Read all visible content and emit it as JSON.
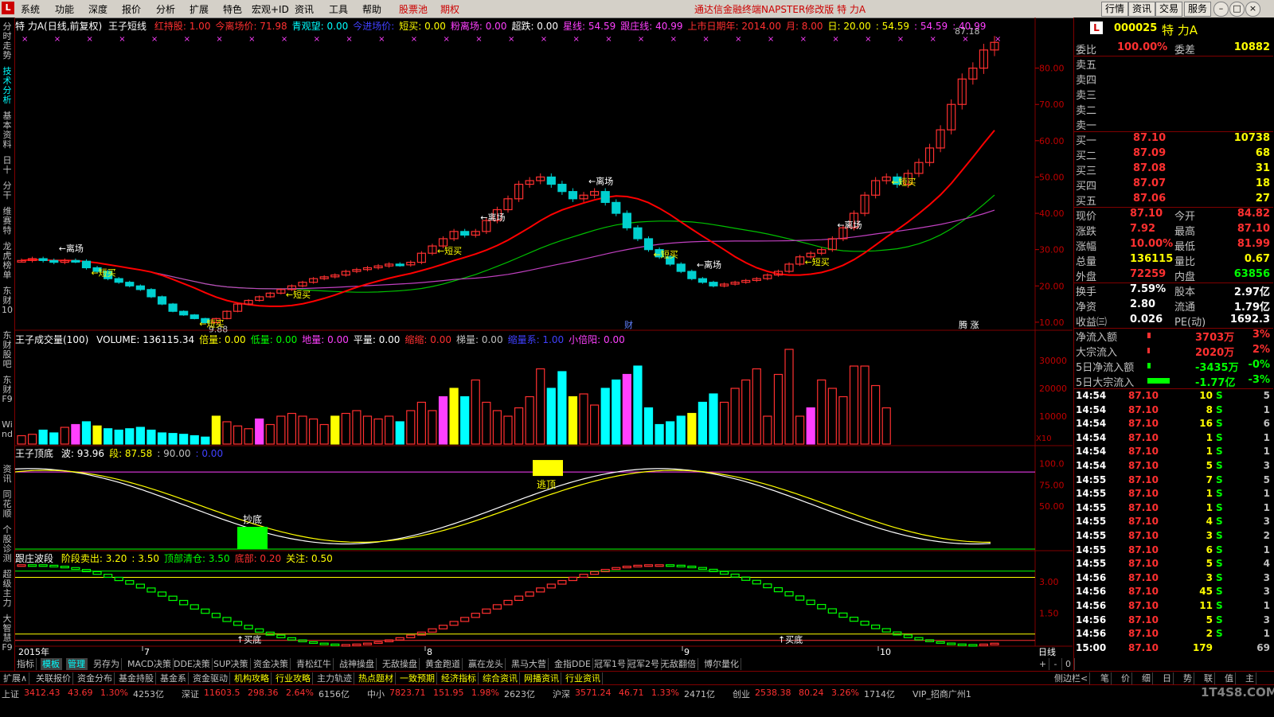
{
  "menu": {
    "logo": "L",
    "items": [
      "系统",
      "功能",
      "深度",
      "报价",
      "分析",
      "扩展",
      "特色",
      "宏观+ID",
      "资讯",
      "工具",
      "帮助"
    ],
    "red_items": [
      "股票池",
      "期权"
    ],
    "title": "通达信金融终端NAPSTER修改版  特  力A",
    "right_buttons": [
      "行情",
      "资讯",
      "交易",
      "服务"
    ]
  },
  "left_tabs": [
    {
      "label": "分时走势",
      "active": false
    },
    {
      "label": "技术分析",
      "active": true
    },
    {
      "label": "基本资料",
      "active": false
    },
    {
      "label": "日十",
      "active": false
    },
    {
      "label": "分干",
      "active": false
    },
    {
      "label": "维赛特",
      "active": false
    },
    {
      "label": "龙虎榜单",
      "active": false
    },
    {
      "label": "东财10",
      "active": false
    },
    {
      "label": "东财股吧",
      "active": false
    },
    {
      "label": "东财F9",
      "active": false
    },
    {
      "label": "Wind",
      "active": false
    },
    {
      "label": "资讯",
      "active": false
    },
    {
      "label": "同花顺",
      "active": false
    },
    {
      "label": "个股诊测",
      "active": false
    },
    {
      "label": "超级主力",
      "active": false
    },
    {
      "label": "大智慧F9",
      "active": false
    }
  ],
  "main_header": {
    "stock": "特 力A(日线,前复权)",
    "indicator": "王子短线",
    "items": [
      {
        "t": "红持股: 1.00",
        "c": "#ff3030"
      },
      {
        "t": "今离场价: 71.98",
        "c": "#ff3030"
      },
      {
        "t": "青观望: 0.00",
        "c": "#00ffff"
      },
      {
        "t": "今进场价:",
        "c": "#4040ff"
      },
      {
        "t": "短买: 0.00",
        "c": "#ffff00"
      },
      {
        "t": "粉离场: 0.00",
        "c": "#ff40ff"
      },
      {
        "t": "超跌: 0.00",
        "c": "#ffffff"
      },
      {
        "t": "星线: 54.59",
        "c": "#ff40ff"
      },
      {
        "t": "跟庄线: 40.99",
        "c": "#ff40ff"
      },
      {
        "t": "上市日期年: 2014.00",
        "c": "#ff3030"
      },
      {
        "t": "月: 8.00",
        "c": "#ff3030"
      },
      {
        "t": "日: 20.00",
        "c": "#ffff00"
      },
      {
        "t": ": 54.59",
        "c": "#ffff00"
      },
      {
        "t": ": 54.59",
        "c": "#ff40ff"
      },
      {
        "t": ": 40.99",
        "c": "#ff40ff"
      }
    ]
  },
  "main_annotations": {
    "high_label": "87.18",
    "low_label": "9.88",
    "leave": "←离场",
    "short_buy": "←短买",
    "fin_tag": "财",
    "right_tags": "腾 涨"
  },
  "main_yaxis": [
    "80.00",
    "70.00",
    "60.00",
    "50.00",
    "40.00",
    "30.00",
    "20.00",
    "10.00"
  ],
  "volume_header": {
    "name": "王子成交量(100)",
    "items": [
      {
        "t": "VOLUME: 136115.34",
        "c": "#ffffff"
      },
      {
        "t": "倍量: 0.00",
        "c": "#ffff00"
      },
      {
        "t": "低量: 0.00",
        "c": "#00ff00"
      },
      {
        "t": "地量: 0.00",
        "c": "#ff40ff"
      },
      {
        "t": "平量: 0.00",
        "c": "#ffffff"
      },
      {
        "t": "缩缩: 0.00",
        "c": "#ff3030"
      },
      {
        "t": "梯量: 0.00",
        "c": "#c0c0c0"
      },
      {
        "t": "缩量系: 1.00",
        "c": "#4040ff"
      },
      {
        "t": "小倍阳: 0.00",
        "c": "#ff40ff"
      }
    ]
  },
  "volume_yaxis": [
    "30000",
    "20000",
    "10000"
  ],
  "volume_unit": "X10",
  "wave_header": {
    "name": "王子顶底",
    "items": [
      {
        "t": "波: 93.96",
        "c": "#ffffff"
      },
      {
        "t": "段: 87.58",
        "c": "#ffff00"
      },
      {
        "t": ": 90.00",
        "c": "#c0c0c0"
      },
      {
        "t": ": 0.00",
        "c": "#4040ff"
      }
    ]
  },
  "wave_labels": {
    "bottom": "抄底",
    "top": "逃顶"
  },
  "wave_yaxis": [
    "100.0",
    "75.00",
    "50.00"
  ],
  "track_header": {
    "name": "跟庄波段",
    "items": [
      {
        "t": "阶段卖出: 3.20",
        "c": "#ffff00"
      },
      {
        "t": ": 3.50",
        "c": "#ffff00"
      },
      {
        "t": "顶部清仓: 3.50",
        "c": "#00ff00"
      },
      {
        "t": "底部: 0.20",
        "c": "#ff3030"
      },
      {
        "t": "关注: 0.50",
        "c": "#ffff00"
      }
    ]
  },
  "track_labels": {
    "buy_bottom": "买底"
  },
  "track_yaxis": [
    "3.00",
    "1.50"
  ],
  "date_axis": {
    "year": "2015年",
    "months": [
      "7",
      "8",
      "9",
      "10"
    ],
    "period": "日线"
  },
  "bottom_tabs": [
    "指标",
    "模板",
    "管理",
    "另存为",
    "MACD决策",
    "DDE决策",
    "SUP决策",
    "资金决策",
    "青松红牛",
    "战神操盘",
    "无敌操盘",
    "黄金跑道",
    "赢在龙头",
    "黑马大营",
    "金指DDE",
    "冠军1号",
    "冠军2号",
    "无敌翻倍",
    "博尔量化"
  ],
  "bottom_tabs_selected": [
    1,
    2
  ],
  "bottom_tabs_right": [
    "+",
    "-",
    "0"
  ],
  "bottom_tabs2": [
    {
      "t": "扩展∧",
      "c": "#c0c0c0"
    },
    {
      "t": "关联报价",
      "c": "#c0c0c0"
    },
    {
      "t": "资金分布",
      "c": "#c0c0c0"
    },
    {
      "t": "基金持股",
      "c": "#c0c0c0"
    },
    {
      "t": "基金系",
      "c": "#c0c0c0"
    },
    {
      "t": "资金驱动",
      "c": "#c0c0c0"
    },
    {
      "t": "机构攻略",
      "c": "#ffff00"
    },
    {
      "t": "行业攻略",
      "c": "#ffff00"
    },
    {
      "t": "主力轨迹",
      "c": "#c0c0c0"
    },
    {
      "t": "热点题材",
      "c": "#ffff00"
    },
    {
      "t": "一致预期",
      "c": "#ffff00"
    },
    {
      "t": "经济指标",
      "c": "#ffff00"
    },
    {
      "t": "综合资讯",
      "c": "#ffff00"
    },
    {
      "t": "网播资讯",
      "c": "#ffff00"
    },
    {
      "t": "行业资讯",
      "c": "#ffff00"
    }
  ],
  "bottom_right2": [
    "侧边栏<",
    "笔",
    "价",
    "细",
    "日",
    "势",
    "联",
    "值",
    "主"
  ],
  "status_items": [
    {
      "t": "上证",
      "c": "#c0c0c0"
    },
    {
      "t": "3412.43",
      "c": "#ff3030"
    },
    {
      "t": "43.69",
      "c": "#ff3030"
    },
    {
      "t": "1.30%",
      "c": "#ff3030"
    },
    {
      "t": "4253亿",
      "c": "#c0c0c0"
    },
    {
      "t": "深证",
      "c": "#c0c0c0"
    },
    {
      "t": "11603.5",
      "c": "#ff3030"
    },
    {
      "t": "298.36",
      "c": "#ff3030"
    },
    {
      "t": "2.64%",
      "c": "#ff3030"
    },
    {
      "t": "6156亿",
      "c": "#c0c0c0"
    },
    {
      "t": "中小",
      "c": "#c0c0c0"
    },
    {
      "t": "7823.71",
      "c": "#ff3030"
    },
    {
      "t": "151.95",
      "c": "#ff3030"
    },
    {
      "t": "1.98%",
      "c": "#ff3030"
    },
    {
      "t": "2623亿",
      "c": "#c0c0c0"
    },
    {
      "t": "沪深",
      "c": "#c0c0c0"
    },
    {
      "t": "3571.24",
      "c": "#ff3030"
    },
    {
      "t": "46.71",
      "c": "#ff3030"
    },
    {
      "t": "1.33%",
      "c": "#ff3030"
    },
    {
      "t": "2471亿",
      "c": "#c0c0c0"
    },
    {
      "t": "创业",
      "c": "#c0c0c0"
    },
    {
      "t": "2538.38",
      "c": "#ff3030"
    },
    {
      "t": "80.24",
      "c": "#ff3030"
    },
    {
      "t": "3.26%",
      "c": "#ff3030"
    },
    {
      "t": "1714亿",
      "c": "#c0c0c0"
    },
    {
      "t": "VIP_招商广州1",
      "c": "#c0c0c0"
    }
  ],
  "watermark": "1T4S8.COM",
  "quote": {
    "logo": "L",
    "code": "000025",
    "name": "特 力A",
    "weibi_label": "委比",
    "weibi": "100.00%",
    "weicha_label": "委差",
    "weicha": "10882",
    "sells": [
      {
        "label": "卖五"
      },
      {
        "label": "卖四"
      },
      {
        "label": "卖三"
      },
      {
        "label": "卖二"
      },
      {
        "label": "卖一"
      }
    ],
    "buys": [
      {
        "label": "买一",
        "price": "87.10",
        "vol": "10738"
      },
      {
        "label": "买二",
        "price": "87.09",
        "vol": "68"
      },
      {
        "label": "买三",
        "price": "87.08",
        "vol": "31"
      },
      {
        "label": "买四",
        "price": "87.07",
        "vol": "18"
      },
      {
        "label": "买五",
        "price": "87.06",
        "vol": "27"
      }
    ],
    "stats": [
      [
        {
          "t": "现价",
          "c": "#c0c0c0"
        },
        {
          "t": "87.10",
          "c": "#ff3030"
        },
        {
          "t": "今开",
          "c": "#c0c0c0"
        },
        {
          "t": "84.82",
          "c": "#ff3030"
        }
      ],
      [
        {
          "t": "涨跌",
          "c": "#c0c0c0"
        },
        {
          "t": "7.92",
          "c": "#ff3030"
        },
        {
          "t": "最高",
          "c": "#c0c0c0"
        },
        {
          "t": "87.10",
          "c": "#ff3030"
        }
      ],
      [
        {
          "t": "涨幅",
          "c": "#c0c0c0"
        },
        {
          "t": "10.00%",
          "c": "#ff3030"
        },
        {
          "t": "最低",
          "c": "#c0c0c0"
        },
        {
          "t": "81.99",
          "c": "#ff3030"
        }
      ],
      [
        {
          "t": "总量",
          "c": "#c0c0c0"
        },
        {
          "t": "136115",
          "c": "#ffff00"
        },
        {
          "t": "量比",
          "c": "#c0c0c0"
        },
        {
          "t": "0.67",
          "c": "#ffff00"
        }
      ],
      [
        {
          "t": "外盘",
          "c": "#c0c0c0"
        },
        {
          "t": "72259",
          "c": "#ff3030"
        },
        {
          "t": "内盘",
          "c": "#c0c0c0"
        },
        {
          "t": "63856",
          "c": "#00ff00"
        }
      ],
      [
        {
          "t": "换手",
          "c": "#c0c0c0"
        },
        {
          "t": "7.59%",
          "c": "#ffffff"
        },
        {
          "t": "股本",
          "c": "#c0c0c0"
        },
        {
          "t": "2.97亿",
          "c": "#ffffff"
        }
      ],
      [
        {
          "t": "净资",
          "c": "#c0c0c0"
        },
        {
          "t": "2.80",
          "c": "#ffffff"
        },
        {
          "t": "流通",
          "c": "#c0c0c0"
        },
        {
          "t": "1.79亿",
          "c": "#ffffff"
        }
      ],
      [
        {
          "t": "收益㈢",
          "c": "#c0c0c0"
        },
        {
          "t": "0.026",
          "c": "#ffffff"
        },
        {
          "t": "PE(动)",
          "c": "#c0c0c0"
        },
        {
          "t": "1692.3",
          "c": "#ffffff"
        }
      ]
    ],
    "flows": [
      {
        "label": "净流入额",
        "value": "3703万",
        "pct": "3%",
        "c": "#ff3030",
        "bar": 0.05
      },
      {
        "label": "大宗流入",
        "value": "2020万",
        "pct": "2%",
        "c": "#ff3030",
        "bar": 0.03
      },
      {
        "label": "5日净流入额",
        "value": "-3435万",
        "pct": "-0%",
        "c": "#00ff00",
        "bar": 0.05
      },
      {
        "label": "5日大宗流入",
        "value": "-1.77亿",
        "pct": "-3%",
        "c": "#00ff00",
        "bar": 0.4
      }
    ],
    "ticks": [
      {
        "time": "14:54",
        "price": "87.10",
        "vol": "10",
        "bs": "S",
        "n": "5"
      },
      {
        "time": "14:54",
        "price": "87.10",
        "vol": "8",
        "bs": "S",
        "n": "1"
      },
      {
        "time": "14:54",
        "price": "87.10",
        "vol": "16",
        "bs": "S",
        "n": "6"
      },
      {
        "time": "14:54",
        "price": "87.10",
        "vol": "1",
        "bs": "S",
        "n": "1"
      },
      {
        "time": "14:54",
        "price": "87.10",
        "vol": "1",
        "bs": "S",
        "n": "1"
      },
      {
        "time": "14:54",
        "price": "87.10",
        "vol": "5",
        "bs": "S",
        "n": "3"
      },
      {
        "time": "14:55",
        "price": "87.10",
        "vol": "7",
        "bs": "S",
        "n": "5"
      },
      {
        "time": "14:55",
        "price": "87.10",
        "vol": "1",
        "bs": "S",
        "n": "1"
      },
      {
        "time": "14:55",
        "price": "87.10",
        "vol": "1",
        "bs": "S",
        "n": "1"
      },
      {
        "time": "14:55",
        "price": "87.10",
        "vol": "4",
        "bs": "S",
        "n": "3"
      },
      {
        "time": "14:55",
        "price": "87.10",
        "vol": "3",
        "bs": "S",
        "n": "2"
      },
      {
        "time": "14:55",
        "price": "87.10",
        "vol": "6",
        "bs": "S",
        "n": "1"
      },
      {
        "time": "14:55",
        "price": "87.10",
        "vol": "5",
        "bs": "S",
        "n": "4"
      },
      {
        "time": "14:56",
        "price": "87.10",
        "vol": "3",
        "bs": "S",
        "n": "3"
      },
      {
        "time": "14:56",
        "price": "87.10",
        "vol": "45",
        "bs": "S",
        "n": "3"
      },
      {
        "time": "14:56",
        "price": "87.10",
        "vol": "11",
        "bs": "S",
        "n": "1"
      },
      {
        "time": "14:56",
        "price": "87.10",
        "vol": "5",
        "bs": "S",
        "n": "3"
      },
      {
        "time": "14:56",
        "price": "87.10",
        "vol": "2",
        "bs": "S",
        "n": "1"
      },
      {
        "time": "15:00",
        "price": "87.10",
        "vol": "179",
        "bs": "",
        "n": "69"
      }
    ]
  },
  "chart_data": {
    "type": "candlestick",
    "ylim": [
      8,
      90
    ],
    "closes": [
      27,
      27.5,
      27,
      26.5,
      27,
      26.8,
      25,
      24,
      22,
      21,
      20,
      19,
      17,
      15,
      13,
      12,
      11,
      9.88,
      11,
      13,
      15,
      16,
      17,
      18,
      19,
      20,
      21,
      22,
      22.5,
      23,
      24,
      24.5,
      25,
      25.5,
      26,
      25.8,
      26.5,
      29,
      31,
      33,
      35,
      34,
      35,
      38,
      41,
      44,
      48,
      49,
      50,
      48,
      46,
      44,
      45,
      46,
      43,
      40,
      36,
      33,
      30,
      28,
      26,
      24,
      22,
      21,
      20,
      20.5,
      21,
      21.5,
      22,
      23,
      24,
      26,
      28,
      29,
      30,
      33,
      36,
      40,
      45,
      49,
      50,
      48,
      51,
      54,
      58,
      63,
      70,
      77,
      80,
      85,
      87.1
    ],
    "vols": [
      300,
      350,
      500,
      400,
      600,
      700,
      800,
      650,
      550,
      500,
      550,
      600,
      500,
      400,
      380,
      350,
      300,
      250,
      1000,
      800,
      650,
      550,
      900,
      700,
      1000,
      1100,
      1000,
      900,
      700,
      1000,
      1100,
      1200,
      1000,
      900,
      1000,
      800,
      1200,
      1500,
      1200,
      1700,
      2000,
      1700,
      2300,
      1500,
      1200,
      1000,
      1300,
      1700,
      2700,
      2000,
      2600,
      1700,
      1800,
      1400,
      2000,
      2300,
      2500,
      2800,
      1300,
      700,
      800,
      1000,
      1100,
      1500,
      1800,
      1500,
      2000,
      2300,
      2700,
      1000,
      2500,
      3400,
      1000,
      1300,
      2300,
      2000,
      1700,
      2800,
      2800,
      2100,
      1300
    ]
  }
}
